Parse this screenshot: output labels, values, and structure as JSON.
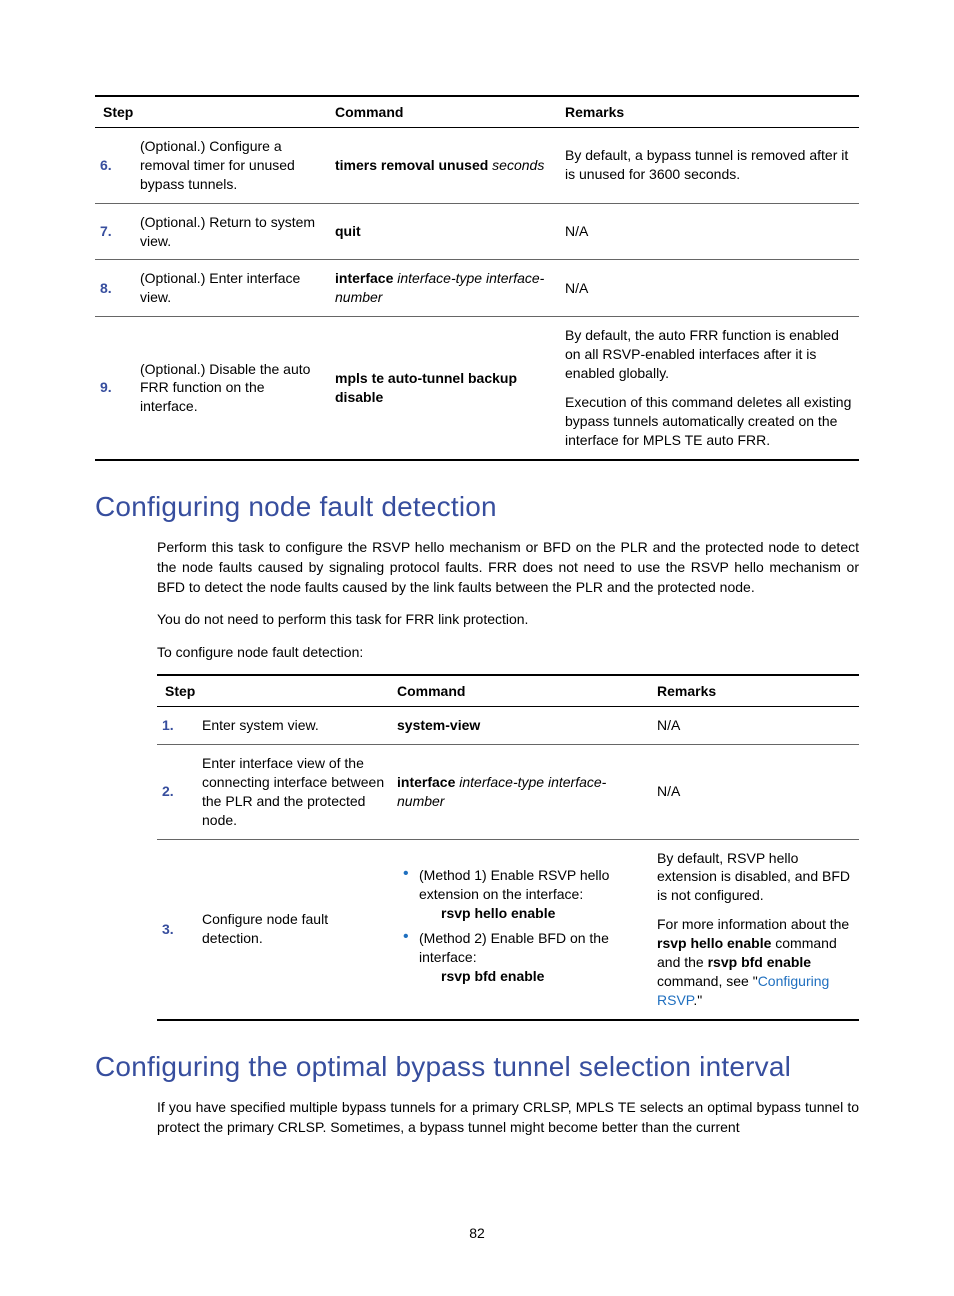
{
  "table1": {
    "headers": {
      "step": "Step",
      "command": "Command",
      "remarks": "Remarks"
    },
    "rows": [
      {
        "num": "6.",
        "step": "(Optional.) Configure a removal timer for unused bypass tunnels.",
        "cmd_bold": "timers removal unused",
        "cmd_ital": " seconds",
        "remarks": "By default, a bypass tunnel is removed after it is unused for 3600 seconds."
      },
      {
        "num": "7.",
        "step": "(Optional.) Return to system view.",
        "cmd_bold": "quit",
        "cmd_ital": "",
        "remarks": "N/A"
      },
      {
        "num": "8.",
        "step": "(Optional.) Enter interface view.",
        "cmd_bold": "interface",
        "cmd_ital": " interface-type interface-number",
        "remarks": "N/A"
      },
      {
        "num": "9.",
        "step": "(Optional.) Disable the auto FRR function on the interface.",
        "cmd_bold": "mpls te auto-tunnel backup disable",
        "cmd_ital": "",
        "remarks_p1": "By default, the auto FRR function is enabled on all RSVP-enabled interfaces after it is enabled globally.",
        "remarks_p2": "Execution of this command deletes all existing bypass tunnels automatically created on the interface for MPLS TE auto FRR."
      }
    ]
  },
  "section1": {
    "title": "Configuring node fault detection",
    "p1": "Perform this task to configure the RSVP hello mechanism or BFD on the PLR and the protected node to detect the node faults caused by signaling protocol faults. FRR does not need to use the RSVP hello mechanism or BFD to detect the node faults caused by the link faults between the PLR and the protected node.",
    "p2": "You do not need to perform this task for FRR link protection.",
    "p3": "To configure node fault detection:"
  },
  "table2": {
    "headers": {
      "step": "Step",
      "command": "Command",
      "remarks": "Remarks"
    },
    "rows": [
      {
        "num": "1.",
        "step": "Enter system view.",
        "cmd_bold": "system-view",
        "remarks": "N/A"
      },
      {
        "num": "2.",
        "step": "Enter interface view of the connecting interface between the PLR and the protected node.",
        "cmd_bold": "interface",
        "cmd_ital": " interface-type interface-number",
        "remarks": "N/A"
      },
      {
        "num": "3.",
        "step": "Configure node fault detection.",
        "method1_text": "(Method 1) Enable RSVP hello extension on the interface:",
        "method1_cmd": "rsvp hello enable",
        "method2_text": "(Method 2) Enable BFD on the interface:",
        "method2_cmd": "rsvp bfd enable",
        "remarks_p1": "By default, RSVP hello extension is disabled, and BFD is not configured.",
        "remarks_p2_a": "For more information about the ",
        "remarks_p2_b": "rsvp hello enable",
        "remarks_p2_c": " command and the ",
        "remarks_p2_d": "rsvp bfd enable",
        "remarks_p2_e": " command, see \"",
        "remarks_p2_link": "Configuring RSVP",
        "remarks_p2_f": ".\""
      }
    ]
  },
  "section2": {
    "title": "Configuring the optimal bypass tunnel selection interval",
    "p1": "If you have specified multiple bypass tunnels for a primary CRLSP, MPLS TE selects an optimal bypass tunnel to protect the primary CRLSP. Sometimes, a bypass tunnel might become better than the current"
  },
  "pagenum": "82"
}
